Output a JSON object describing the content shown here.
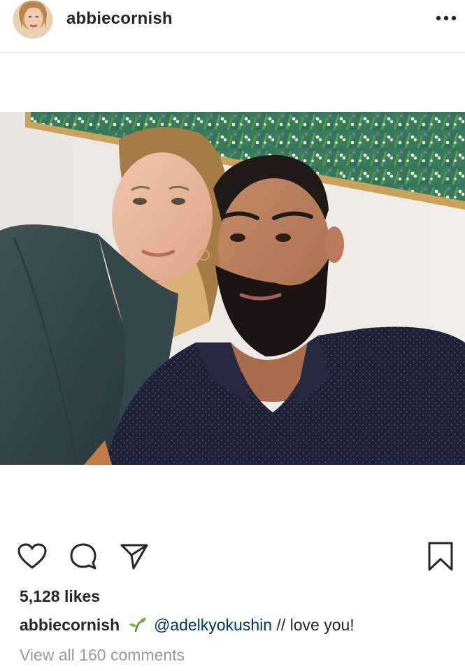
{
  "header": {
    "username": "abbiecornish",
    "avatar_icon": "profile-photo",
    "more_icon": "more-horizontal-icon"
  },
  "post": {
    "image_icon": "post-photo"
  },
  "actions": {
    "like_icon": "heart-icon",
    "comment_icon": "comment-icon",
    "share_icon": "paper-plane-icon",
    "save_icon": "bookmark-icon"
  },
  "likes": {
    "text": "5,128 likes"
  },
  "caption": {
    "username": "abbiecornish",
    "emoji_icon": "seedling-icon",
    "mention": "@adelkyokushin",
    "text": " // love you!"
  },
  "comments": {
    "link_text": "View all 160 comments"
  },
  "colors": {
    "text": "#262626",
    "mention": "#003569",
    "muted": "#999999",
    "divider": "#e6e6e6"
  }
}
